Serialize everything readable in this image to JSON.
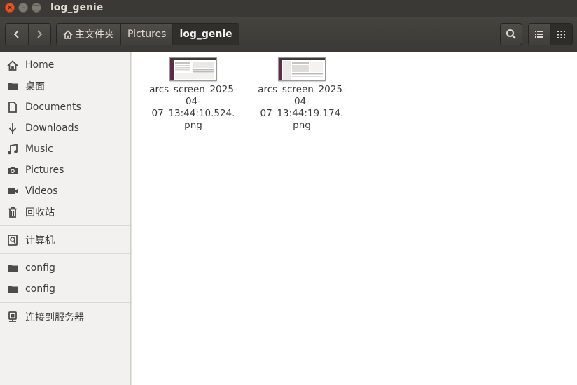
{
  "window": {
    "title": "log_genie"
  },
  "header": {
    "breadcrumbs": [
      "主文件夹",
      "Pictures",
      "log_genie"
    ]
  },
  "sidebar": {
    "items": [
      {
        "label": "Home",
        "icon": "home-icon"
      },
      {
        "label": "桌面",
        "icon": "folder-icon"
      },
      {
        "label": "Documents",
        "icon": "document-icon"
      },
      {
        "label": "Downloads",
        "icon": "download-icon"
      },
      {
        "label": "Music",
        "icon": "music-icon"
      },
      {
        "label": "Pictures",
        "icon": "camera-icon"
      },
      {
        "label": "Videos",
        "icon": "video-icon"
      },
      {
        "label": "回收站",
        "icon": "trash-icon"
      },
      {
        "label": "计算机",
        "icon": "computer-icon"
      },
      {
        "label": "config",
        "icon": "folder-icon"
      },
      {
        "label": "config",
        "icon": "folder-icon"
      },
      {
        "label": "连接到服务器",
        "icon": "server-icon"
      }
    ]
  },
  "files": [
    {
      "name": "arcs_screen_2025-04-07_13:44:10.524.png",
      "line1": "arcs_screen_2025-",
      "line2": "04-07_13:44:10.524.",
      "line3": "png"
    },
    {
      "name": "arcs_screen_2025-04-07_13:44:19.174.png",
      "line1": "arcs_screen_2025-",
      "line2": "04-07_13:44:19.174.",
      "line3": "png"
    }
  ],
  "colors": {
    "accent": "#e95420",
    "titlebar": "#3a3935",
    "sidebar": "#f2f1f0"
  }
}
